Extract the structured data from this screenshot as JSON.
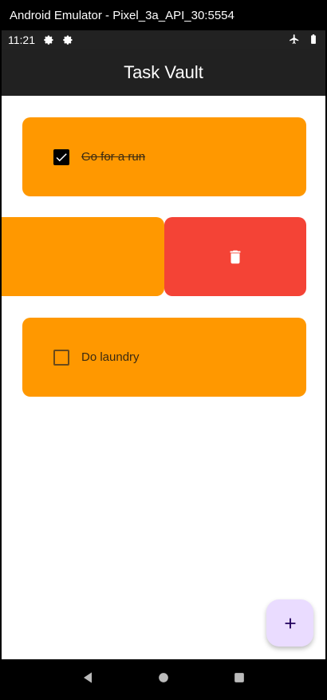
{
  "window": {
    "title": "Android Emulator - Pixel_3a_API_30:5554"
  },
  "status_bar": {
    "time": "11:21",
    "icons": [
      "settings-icon",
      "settings-icon",
      "airplane-icon",
      "battery-icon"
    ]
  },
  "app_bar": {
    "title": "Task Vault"
  },
  "tasks": [
    {
      "label": "Go for a run",
      "checked": true
    },
    {
      "label": "",
      "checked": false,
      "swiping": true
    },
    {
      "label": "Do laundry",
      "checked": false
    }
  ],
  "swipe_action": {
    "icon": "trash-icon",
    "color": "#F44336"
  },
  "colors": {
    "card": "#FF9800",
    "appbar": "#212121",
    "fab": "#EADCFF",
    "delete": "#F44336"
  },
  "fab": {
    "label": "+",
    "icon": "plus-icon"
  },
  "nav_bar": {
    "buttons": [
      "back-icon",
      "home-icon",
      "recents-icon"
    ]
  }
}
